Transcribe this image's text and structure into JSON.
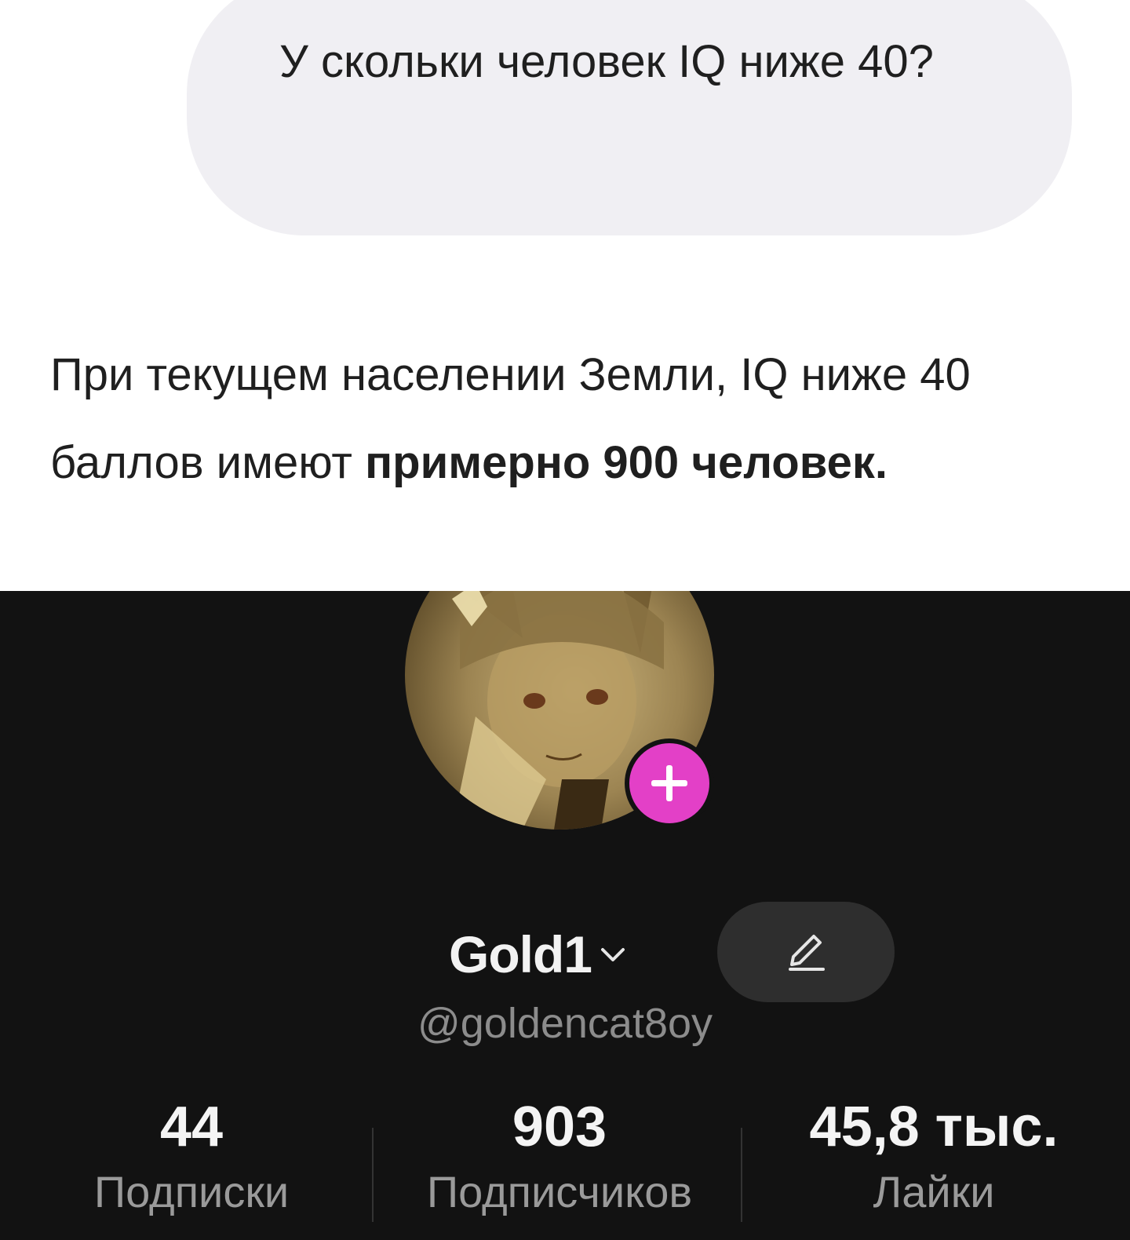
{
  "chat": {
    "user_message": "У скольки человек IQ ниже 40?",
    "ai_answer_prefix": "При текущем населении Земли, IQ ниже 40 баллов имеют ",
    "ai_answer_bold": "примерно 900 человек."
  },
  "profile": {
    "display_name": "Gold1",
    "handle": "@goldencat8oy",
    "accent_color": "#e340c7",
    "icons": [
      "plus-icon",
      "chevron-down-icon",
      "pencil-icon"
    ],
    "stats": [
      {
        "value": "44",
        "label": "Подписки"
      },
      {
        "value": "903",
        "label": "Подписчиков"
      },
      {
        "value": "45,8 тыс.",
        "label": "Лайки"
      }
    ]
  }
}
